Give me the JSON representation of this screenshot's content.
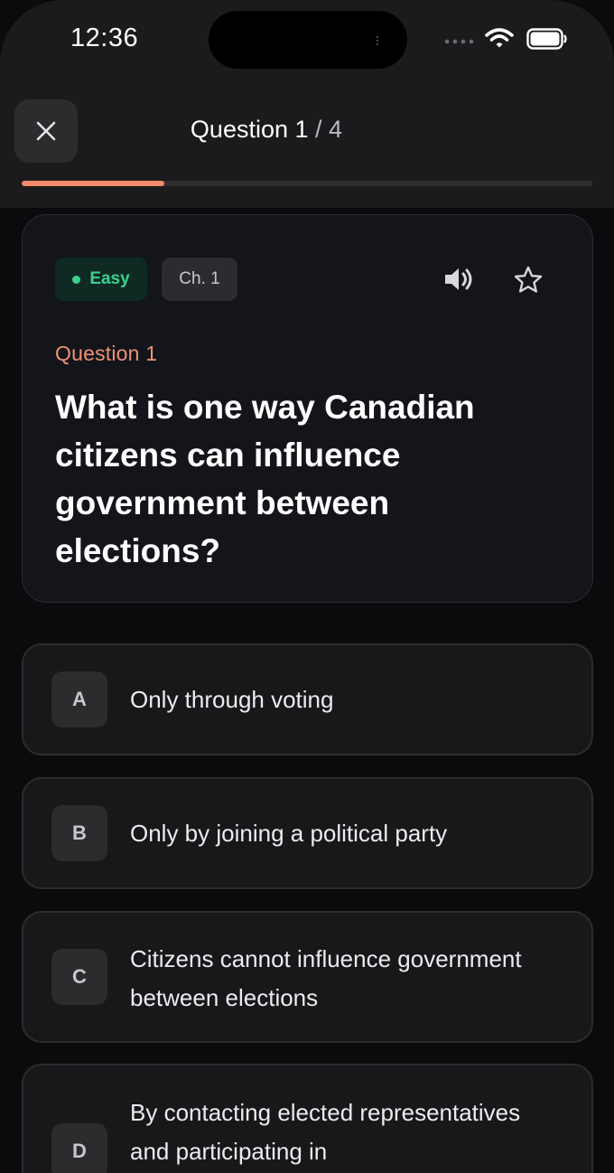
{
  "status_bar": {
    "time": "12:36"
  },
  "header": {
    "title_prefix": "Question 1",
    "title_suffix": "/ 4",
    "progress_fraction": 0.25
  },
  "question_card": {
    "difficulty": "Easy",
    "chapter": "Ch. 1",
    "label": "Question 1",
    "text": "What is one way Canadian citizens can influence government between elections?"
  },
  "options": [
    {
      "letter": "A",
      "text": "Only through voting"
    },
    {
      "letter": "B",
      "text": "Only by joining a political party"
    },
    {
      "letter": "C",
      "text": "Citizens cannot influence government between elections"
    },
    {
      "letter": "D",
      "text": "By contacting elected representatives and participating in"
    }
  ],
  "colors": {
    "accent": "#ef8a6c",
    "easy_green": "#3ccf91",
    "background": "#0b0b0d",
    "card": "#13151a"
  },
  "icons": [
    "close-icon",
    "speaker-icon",
    "star-icon",
    "wifi-icon",
    "battery-icon",
    "signal-icon"
  ]
}
